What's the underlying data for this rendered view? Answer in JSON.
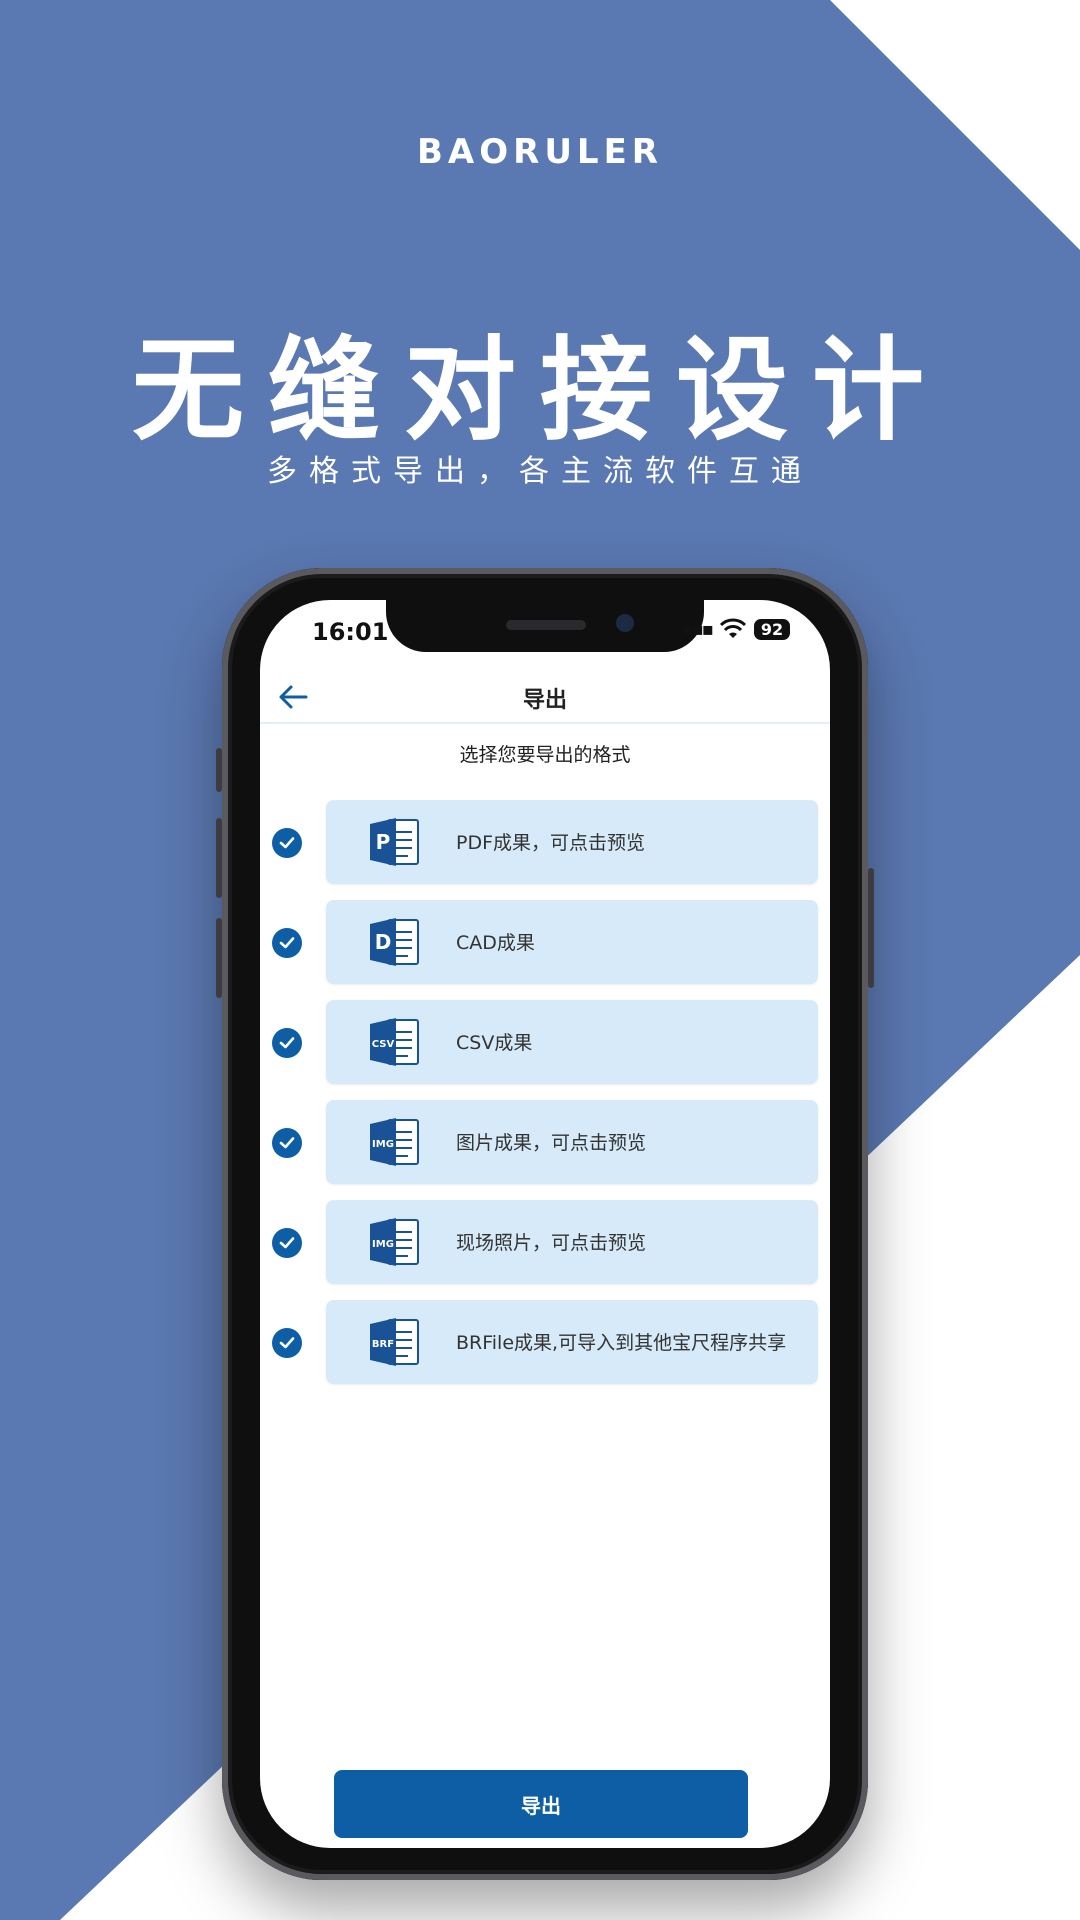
{
  "banner": {
    "brand": "BAORULER",
    "headline": "无缝对接设计",
    "subline": "多格式导出，各主流软件互通"
  },
  "status_bar": {
    "time": "16:01",
    "battery": "92"
  },
  "nav": {
    "title": "导出"
  },
  "prompt": "选择您要导出的格式",
  "options": [
    {
      "icon_text": "P",
      "label": "PDF成果，可点击预览",
      "checked": true
    },
    {
      "icon_text": "D",
      "label": "CAD成果",
      "checked": true
    },
    {
      "icon_text": "CSV",
      "label": "CSV成果",
      "checked": true
    },
    {
      "icon_text": "IMG",
      "label": "图片成果，可点击预览",
      "checked": true
    },
    {
      "icon_text": "IMG",
      "label": "现场照片，可点击预览",
      "checked": true
    },
    {
      "icon_text": "BRF",
      "label": "BRFile成果,可导入到其他宝尺程序共享",
      "checked": true
    }
  ],
  "export_button": "导出",
  "colors": {
    "background": "#5a78b1",
    "accent": "#0e5ea5",
    "card": "#d6eaf9"
  }
}
